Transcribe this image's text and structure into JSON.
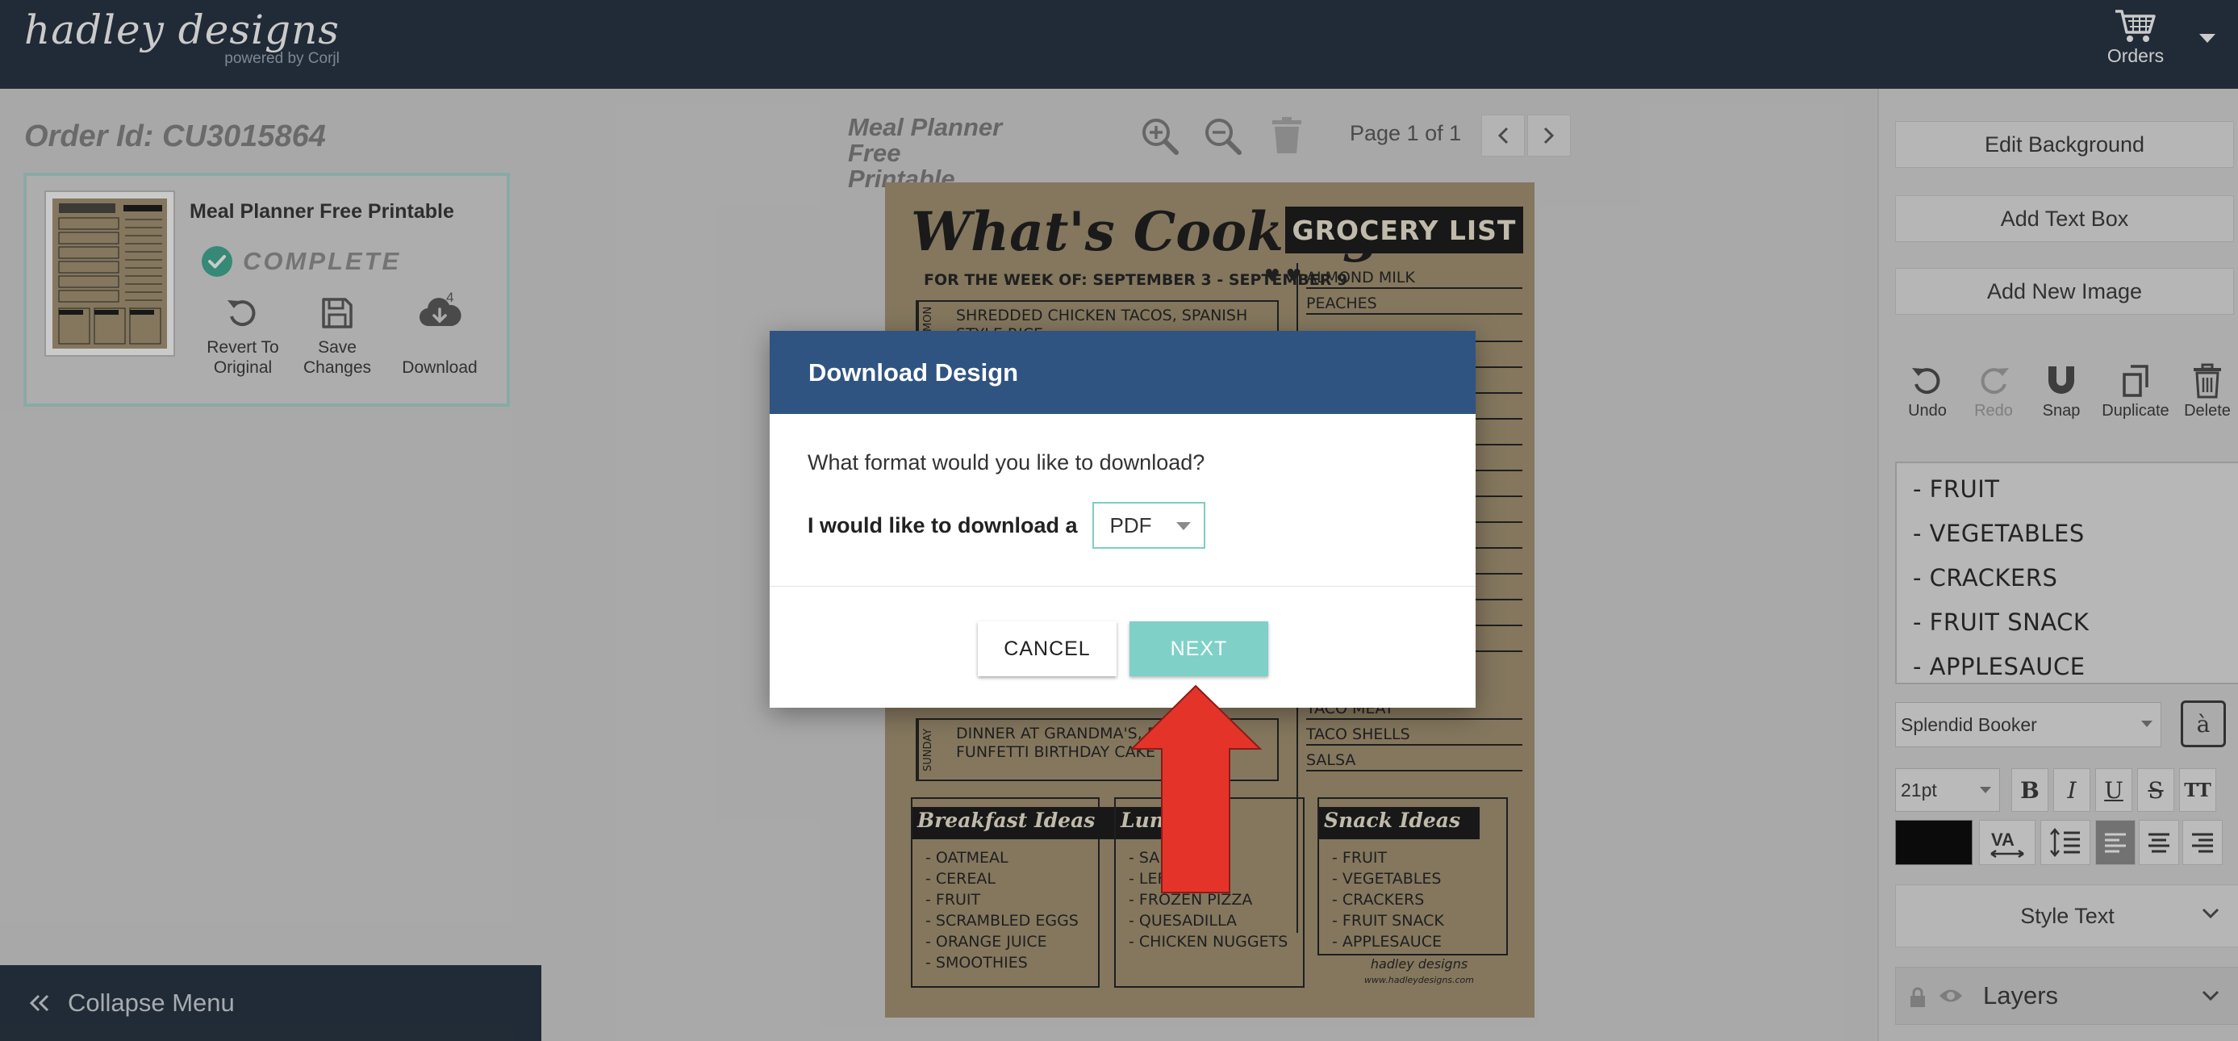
{
  "topbar": {
    "brand": "hadley designs",
    "powered": "powered by Corjl",
    "orders_label": "Orders"
  },
  "left": {
    "order_id": "Order Id: CU3015864",
    "card_title": "Meal Planner Free Printable",
    "status": "COMPLETE",
    "actions": {
      "revert_l1": "Revert To",
      "revert_l2": "Original",
      "save_l1": "Save",
      "save_l2": "Changes",
      "download": "Download",
      "download_count": "4"
    },
    "collapse_label": "Collapse Menu"
  },
  "canvas": {
    "doc_title_l1": "Meal Planner Free",
    "doc_title_l2": "Printable",
    "page_info": "Page 1 of 1"
  },
  "design": {
    "title": "What's Cooking?",
    "grocery_banner": "GROCERY LIST",
    "week": "FOR THE WEEK OF: SEPTEMBER 3 - SEPTEMBER 9",
    "monday_day": "MON",
    "monday": "SHREDDED CHICKEN TACOS, SPANISH STYLE RICE",
    "sunday_day": "SUNDAY",
    "sunday_l1": "DINNER AT GRANDMA'S, BRING",
    "sunday_l1b": "E -",
    "sunday_l2": "FUNFETTI BIRTHDAY CAKE",
    "grocery": [
      "ALMOND MILK",
      "PEACHES",
      "TACO MEAT",
      "TACO SHELLS",
      "SALSA"
    ],
    "breakfast_title": "Breakfast Ideas",
    "breakfast": [
      "- OATMEAL",
      "- CEREAL",
      "- FRUIT",
      "- SCRAMBLED EGGS",
      "- ORANGE JUICE",
      "- SMOOTHIES"
    ],
    "lunch_title": "Lunch",
    "lunch": [
      "- SAND",
      "- LEFTO",
      "- FROZEN PIZZA",
      "- QUESADILLA",
      "- CHICKEN NUGGETS"
    ],
    "snack_title": "Snack Ideas",
    "snack": [
      "- FRUIT",
      "- VEGETABLES",
      "- CRACKERS",
      "- FRUIT SNACK",
      "- APPLESAUCE"
    ],
    "footer_brand": "hadley designs",
    "footer_url": "www.hadleydesigns.com"
  },
  "right": {
    "edit_background": "Edit Background",
    "add_text_box": "Add Text Box",
    "add_new_image": "Add New Image",
    "undo": "Undo",
    "redo": "Redo",
    "snap": "Snap",
    "duplicate": "Duplicate",
    "delete": "Delete",
    "text_items": [
      "- FRUIT",
      "- VEGETABLES",
      "- CRACKERS",
      "- FRUIT SNACK",
      "- APPLESAUCE"
    ],
    "font": "Splendid Booker",
    "glyph": "à",
    "size": "21pt",
    "bold": "B",
    "italic": "I",
    "underline": "U",
    "strike": "S",
    "caps": "TT",
    "color": "#000000",
    "style_text": "Style Text",
    "layers": "Layers"
  },
  "modal": {
    "title": "Download Design",
    "question": "What format would you like to download?",
    "row_label": "I would like to download a",
    "format": "PDF",
    "cancel": "CANCEL",
    "next": "NEXT"
  },
  "colors": {
    "topbar": "#1e2b3b",
    "modal_header": "#2f5482",
    "next_button": "#7fd1c7",
    "status_check": "#3aa88f",
    "arrow": "#e4342a"
  }
}
